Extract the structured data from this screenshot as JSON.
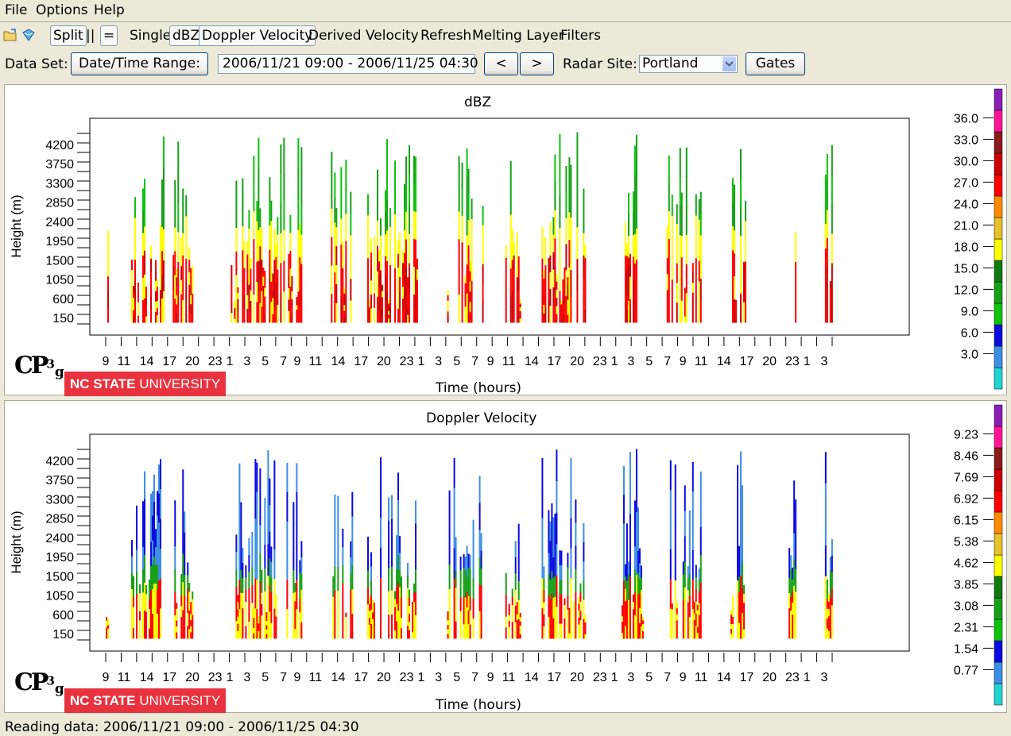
{
  "menu": {
    "file": "File",
    "options": "Options",
    "help": "Help"
  },
  "toolbar": {
    "split": "Split",
    "pause": "||",
    "equal": "=",
    "single": "Single",
    "dbz": "dBZ",
    "doppler": "Doppler Velocity",
    "derived": "Derived Velocity",
    "refresh": "Refresh",
    "melting": "Melting Layer",
    "filters": "Filters"
  },
  "dataset": {
    "label": "Data Set:",
    "range_button": "Date/Time Range:",
    "range_value": "2006/11/21 09:00 - 2006/11/25 04:30",
    "prev": "<",
    "next": ">",
    "site_label": "Radar Site:",
    "site_value": "Portland",
    "gates": "Gates"
  },
  "xticks": [
    "9",
    "11",
    "14",
    "17",
    "20",
    "23",
    "1",
    "3",
    "5",
    "7",
    "9",
    "11",
    "14",
    "17",
    "20",
    "23",
    "1",
    "3",
    "5",
    "7",
    "9",
    "11",
    "14",
    "17",
    "20",
    "23",
    "1",
    "3",
    "5",
    "7",
    "9",
    "11",
    "14",
    "17",
    "20",
    "23",
    "1",
    "3"
  ],
  "yticks": [
    "150",
    "600",
    "1050",
    "1500",
    "1950",
    "2400",
    "2850",
    "3300",
    "3750",
    "4200"
  ],
  "logo": {
    "cpg": "CP",
    "sup": "3",
    "sub": "g",
    "ncsu_bold": "NC STATE",
    "ncsu_light": "UNIVERSITY"
  },
  "colors": {
    "dbz": [
      "#22d3d3",
      "#3d8ee6",
      "#0a0ae0",
      "#0cc30c",
      "#16a016",
      "#117a11",
      "#ffff00",
      "#e7c22a",
      "#ff8c00",
      "#ff0000",
      "#cc0000",
      "#8b1a1a",
      "#ff1493",
      "#8a1fb5"
    ],
    "vel": [
      "#22d3d3",
      "#3d8ee6",
      "#0a0ae0",
      "#0cc30c",
      "#16a016",
      "#117a11",
      "#ffff00",
      "#e7c22a",
      "#ff8c00",
      "#ff0000",
      "#cc0000",
      "#8b1a1a",
      "#ff1493",
      "#8a1fb5"
    ]
  },
  "plots": [
    {
      "title": "dBZ",
      "ylabel": "Height (m)",
      "xlabel": "Time (hours)",
      "legend": [
        "3.0",
        "6.0",
        "9.0",
        "12.0",
        "15.0",
        "18.0",
        "21.0",
        "24.0",
        "27.0",
        "30.0",
        "33.0",
        "36.0"
      ]
    },
    {
      "title": "Doppler Velocity",
      "ylabel": "Height (m)",
      "xlabel": "Time (hours)",
      "legend": [
        "0.77",
        "1.54",
        "2.31",
        "3.08",
        "3.85",
        "4.62",
        "5.38",
        "6.15",
        "6.92",
        "7.69",
        "8.46",
        "9.23"
      ]
    }
  ],
  "status": "Reading data: 2006/11/21 09:00 - 2006/11/25 04:30"
}
